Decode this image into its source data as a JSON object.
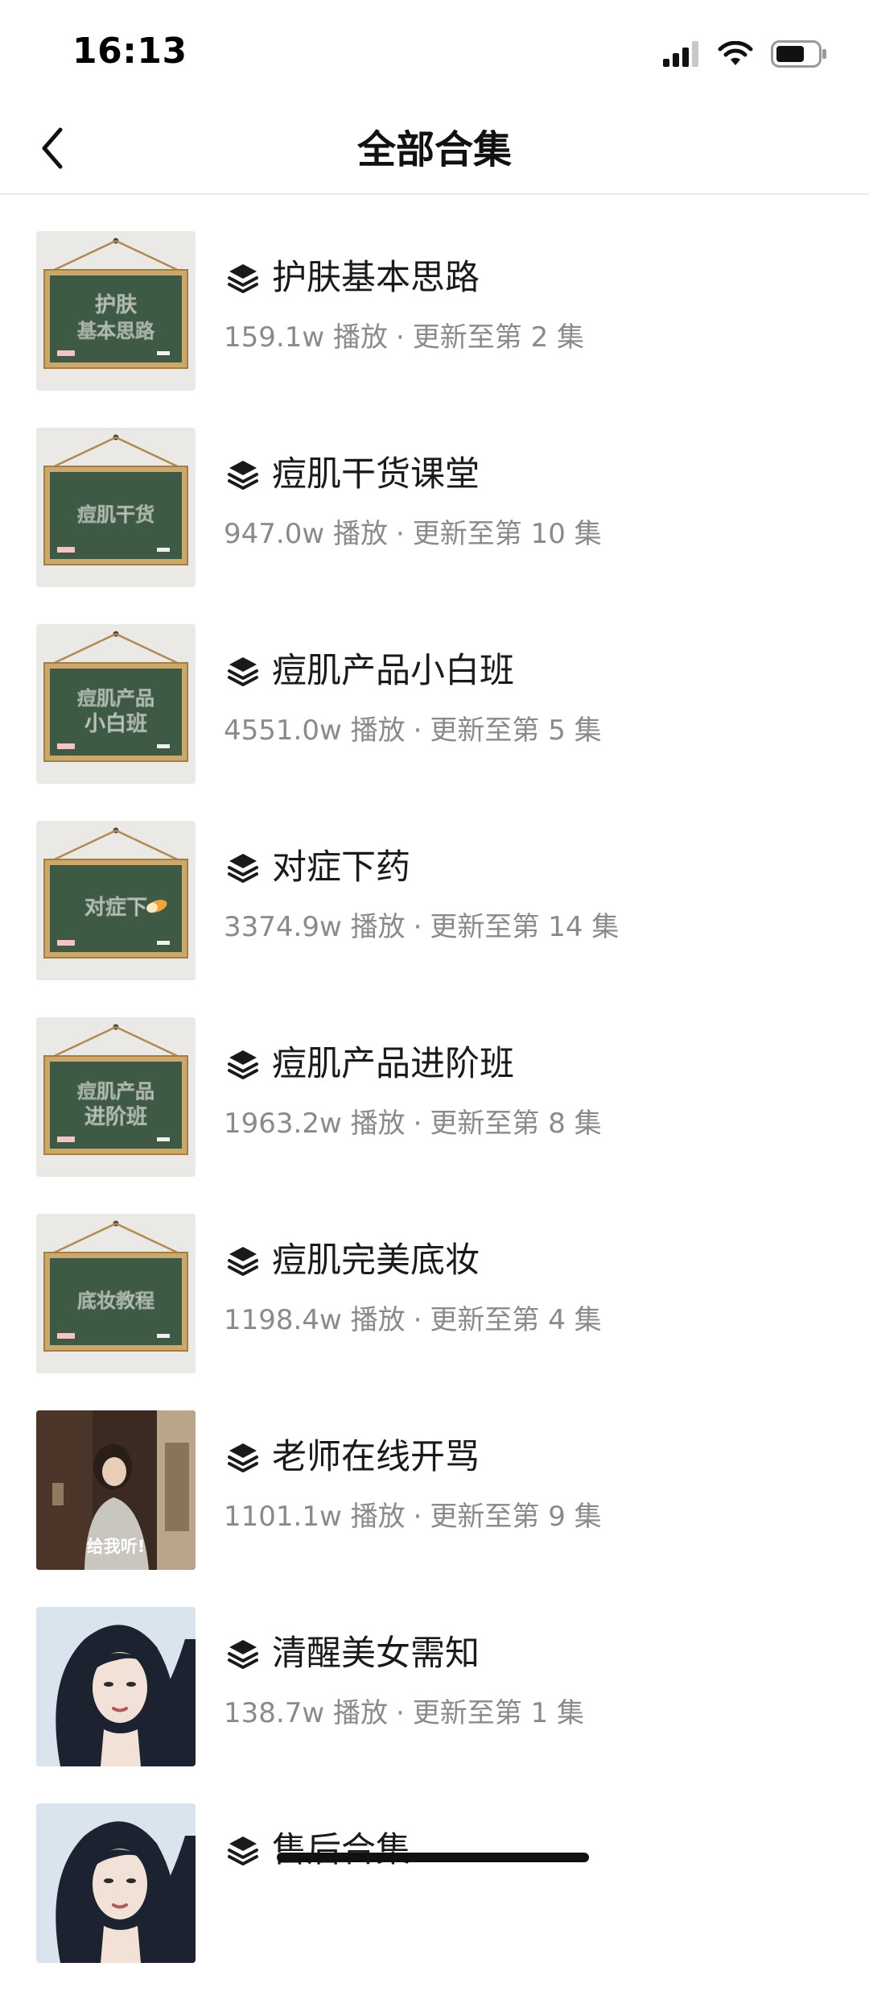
{
  "status_bar": {
    "time": "16:13"
  },
  "nav": {
    "title": "全部合集"
  },
  "collections": [
    {
      "title": "护肤基本思路",
      "plays": "159.1w 播放",
      "update": "更新至第 2 集",
      "thumb_lines": [
        "护肤",
        "基本思路"
      ]
    },
    {
      "title": "痘肌干货课堂",
      "plays": "947.0w 播放",
      "update": "更新至第 10 集",
      "thumb_lines": [
        "痘肌干货"
      ]
    },
    {
      "title": "痘肌产品小白班",
      "plays": "4551.0w 播放",
      "update": "更新至第 5 集",
      "thumb_lines": [
        "痘肌产品",
        "小白班"
      ]
    },
    {
      "title": "对症下药",
      "plays": "3374.9w 播放",
      "update": "更新至第 14 集",
      "thumb_lines": [
        "对症下"
      ]
    },
    {
      "title": "痘肌产品进阶班",
      "plays": "1963.2w 播放",
      "update": "更新至第 8 集",
      "thumb_lines": [
        "痘肌产品",
        "进阶班"
      ]
    },
    {
      "title": "痘肌完美底妆",
      "plays": "1198.4w 播放",
      "update": "更新至第 4 集",
      "thumb_lines": [
        "底妆教程"
      ]
    },
    {
      "title": "老师在线开骂",
      "plays": "1101.1w 播放",
      "update": "更新至第 9 集",
      "thumb_caption": "给我听!"
    },
    {
      "title": "清醒美女需知",
      "plays": "138.7w 播放",
      "update": "更新至第 1 集"
    },
    {
      "title": "售后合集",
      "plays": "",
      "update": ""
    }
  ],
  "separator": "·",
  "colors": {
    "board": "#3f5a44",
    "frame": "#c9a56b",
    "background": "#ffffff",
    "meta_text": "#8a8a8a"
  }
}
